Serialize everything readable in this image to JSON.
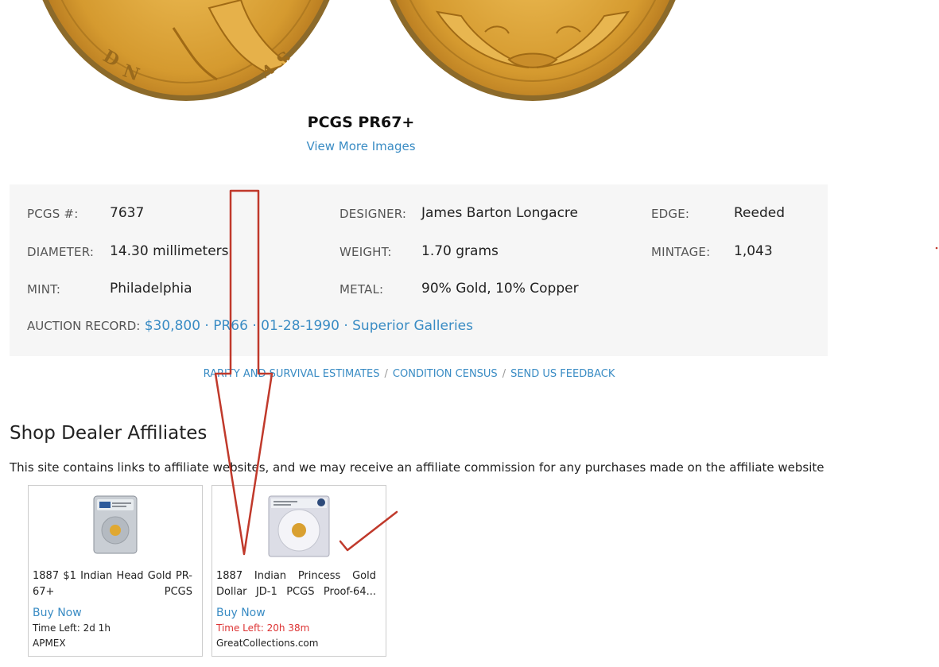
{
  "hero": {
    "grade": "PCGS PR67+",
    "view_more": "View More Images"
  },
  "specs": {
    "pcgs_label": "PCGS #:",
    "pcgs_value": "7637",
    "designer_label": "DESIGNER:",
    "designer_value": "James Barton Longacre",
    "edge_label": "EDGE:",
    "edge_value": "Reeded",
    "diameter_label": "DIAMETER:",
    "diameter_value": "14.30 millimeters",
    "weight_label": "WEIGHT:",
    "weight_value": "1.70 grams",
    "mintage_label": "MINTAGE:",
    "mintage_value": "1,043",
    "mint_label": "MINT:",
    "mint_value": "Philadelphia",
    "metal_label": "METAL:",
    "metal_value": "90% Gold, 10% Copper",
    "auction_label": "AUCTION RECORD:",
    "auction_value": "$30,800 · PR66 · 01-28-1990 · Superior Galleries"
  },
  "links": {
    "rarity": "RARITY AND SURVIVAL ESTIMATES",
    "census": "CONDITION CENSUS",
    "feedback": "SEND US FEEDBACK",
    "separator": "/"
  },
  "affiliates": {
    "title": "Shop Dealer Affiliates",
    "disclosure": "This site contains links to affiliate websites, and we may receive an affiliate commission for any purchases made on the affiliate website u",
    "cards": [
      {
        "description": "1887 $1 Indian Head Gold PR-67+ PCGS",
        "buy_label": "Buy Now",
        "time_left": "Time Left: 2d 1h",
        "dealer": "APMEX"
      },
      {
        "description": "1887 Indian Princess Gold Dollar JD-1 PCGS Proof-64...",
        "buy_label": "Buy Now",
        "time_left": "Time Left: 20h 38m",
        "dealer": "GreatCollections.com"
      }
    ]
  },
  "colors": {
    "link": "#3a8cc4",
    "urgent": "#d33333",
    "annotation": "#c0392b",
    "gold": "#d9a441"
  }
}
